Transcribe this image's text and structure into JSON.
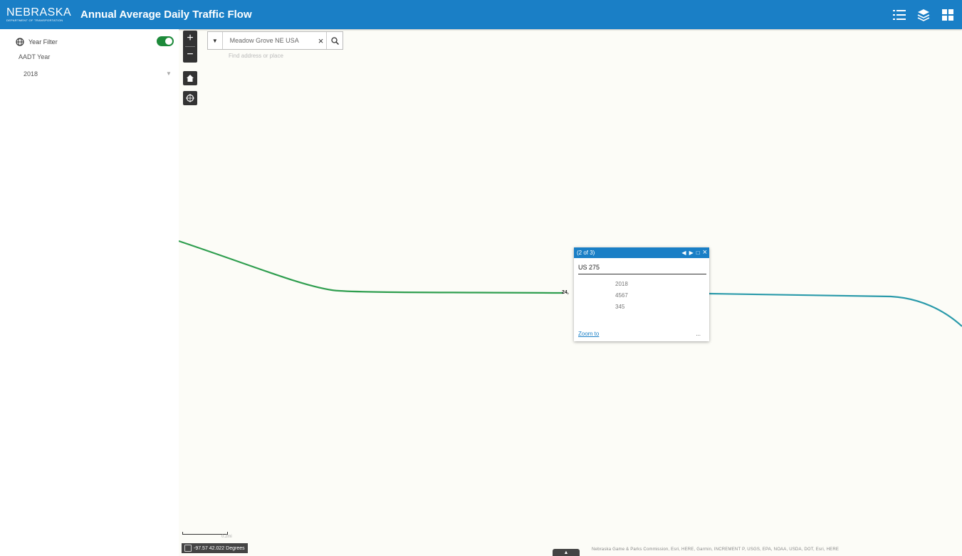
{
  "header": {
    "logo_text": "NEBRASKA",
    "logo_subtext": "DEPARTMENT OF TRANSPORTATION",
    "title": "Annual Average Daily Traffic Flow",
    "tools": [
      "legend-icon",
      "layers-icon",
      "basemap-gallery-icon"
    ]
  },
  "filter": {
    "label": "Year Filter",
    "enabled": true,
    "field_label": "AADT Year",
    "value": "2018"
  },
  "search": {
    "value": "Meadow Grove NE USA",
    "hint": "Find address or place"
  },
  "popup": {
    "counter": "(2 of 3)",
    "title": "US 275",
    "rows": [
      {
        "value": "2018"
      },
      {
        "value": "4567"
      },
      {
        "value": "345"
      }
    ],
    "zoom_label": "Zoom to",
    "more_label": "..."
  },
  "map": {
    "road_label": "24,",
    "scale_label": "0.2mi",
    "coordinates": "-97.57 42.022 Degrees",
    "attribution": "Nebraska Game & Parks Commission, Esri, HERE, Garmin, INCREMENT P, USGS, EPA, NOAA, USDA, DOT, Esri, HERE"
  },
  "colors": {
    "header": "#1a7fc6",
    "toggle": "#1d8a3a",
    "road_west": "#2f9e4f",
    "road_east": "#2a9aaa",
    "map_bg": "#fcfcf7"
  }
}
